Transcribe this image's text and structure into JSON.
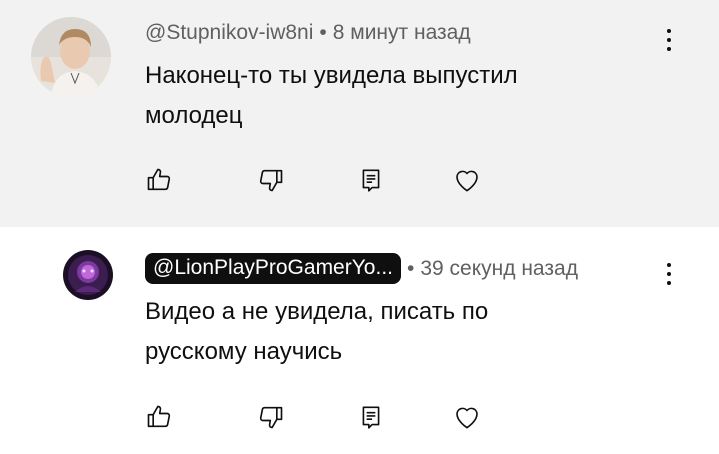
{
  "comments": [
    {
      "author": "@Stupnikov-iw8ni",
      "time": "8 минут назад",
      "text_line1": "Наконец-то ты увидела выпустил",
      "text_line2": "молодец",
      "highlighted": true
    },
    {
      "author": "@LionPlayProGamerYo...",
      "time": "39 секунд назад",
      "text_line1": "Видео а не увидела, писать по",
      "text_line2": "русскому научись",
      "highlighted": false
    }
  ],
  "separator": "•",
  "colors": {
    "highlight_bg": "#f2f2f2",
    "text_primary": "#0f0f0f",
    "text_secondary": "#606060",
    "chip_bg": "#0f0f0f"
  },
  "icons": {
    "like": "thumb-up-icon",
    "dislike": "thumb-down-icon",
    "reply": "reply-comment-icon",
    "heart": "heart-icon",
    "more": "more-vert-icon"
  }
}
